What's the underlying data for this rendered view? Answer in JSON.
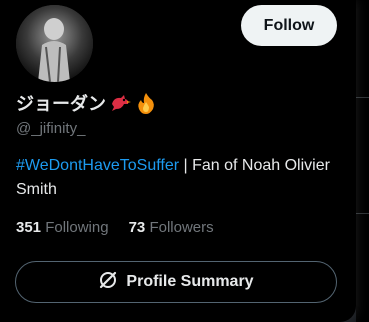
{
  "profile": {
    "display_name": "ジョーダン",
    "handle": "@_jifinity_",
    "bio_hashtag": "#WeDontHaveToSuffer",
    "bio_text": " | Fan of Noah Olivier Smith",
    "following_count": "351",
    "following_label": "Following",
    "followers_count": "73",
    "followers_label": "Followers",
    "name_emojis": [
      "bird-emoji",
      "fire-emoji"
    ]
  },
  "actions": {
    "follow_label": "Follow",
    "profile_summary_label": "Profile Summary"
  },
  "colors": {
    "accent": "#1d9bf0",
    "background": "#000000",
    "muted_text": "#71767b",
    "follow_button_bg": "#eff3f4"
  }
}
